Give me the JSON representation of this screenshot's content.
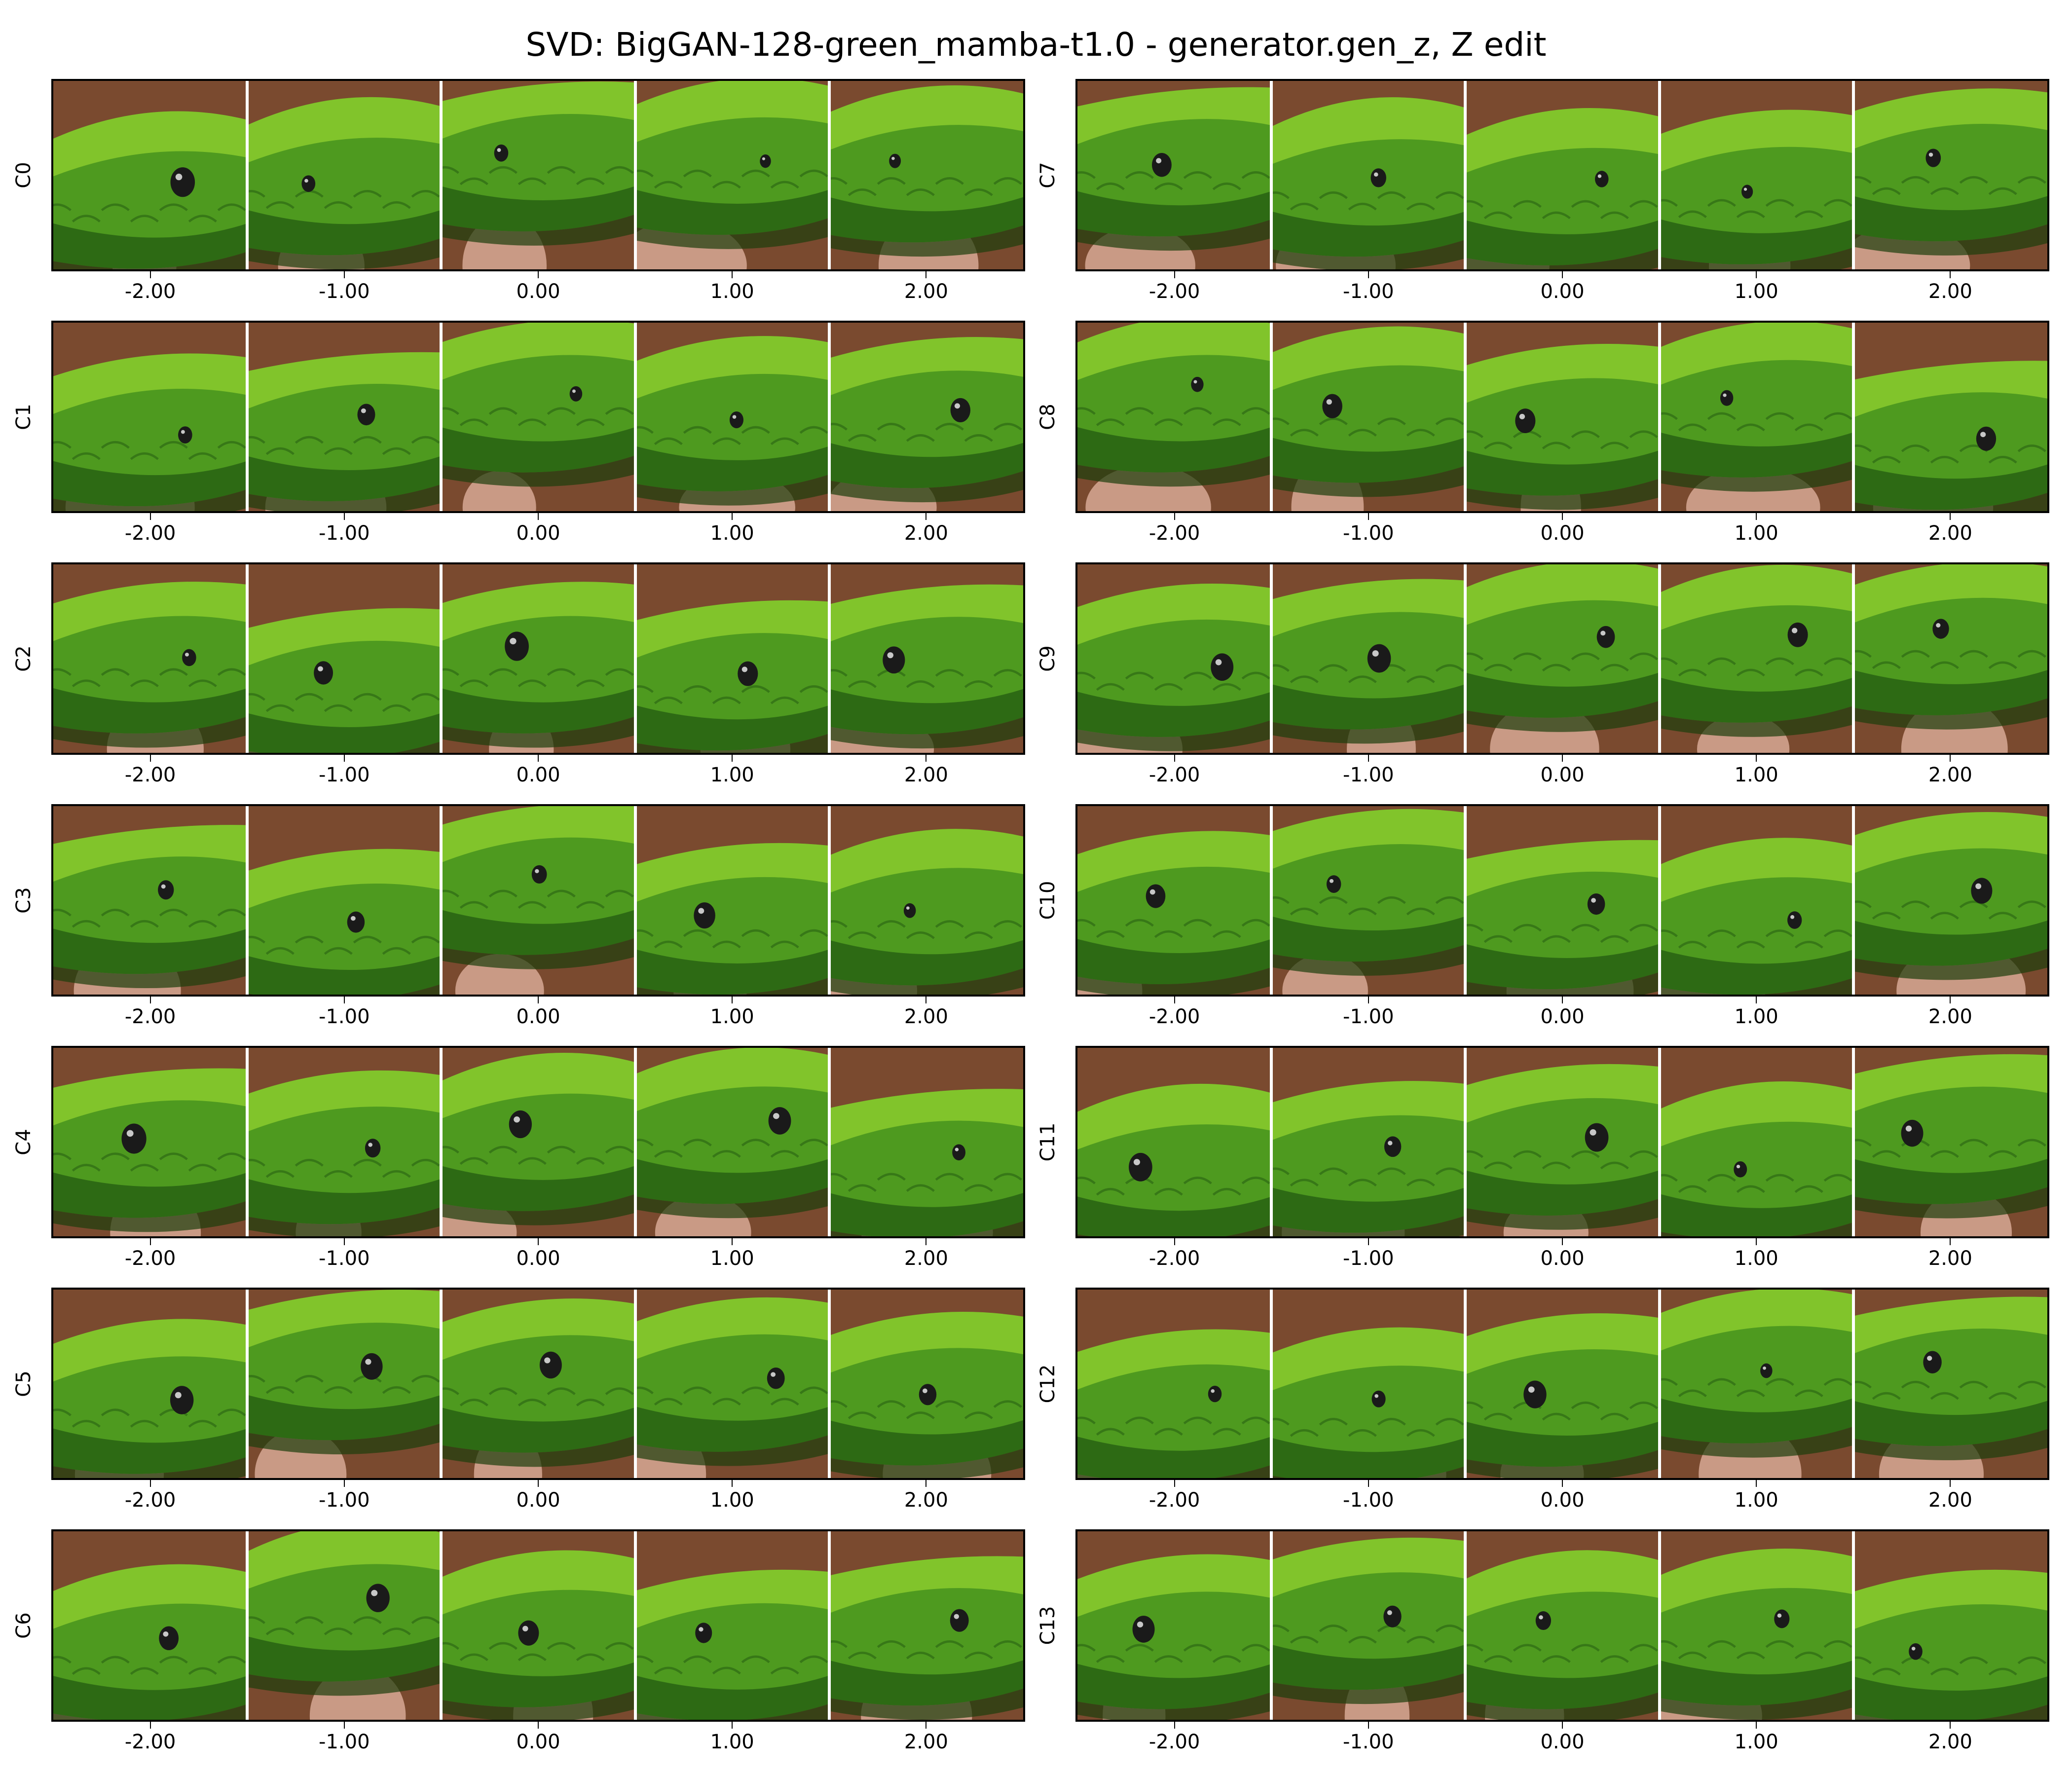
{
  "title": "SVD: BigGAN-128-green_mamba-t1.0 - generator.gen_z, Z edit",
  "tick_labels": [
    "-2.00",
    "-1.00",
    "0.00",
    "1.00",
    "2.00"
  ],
  "components": [
    "C0",
    "C1",
    "C2",
    "C3",
    "C4",
    "C5",
    "C6",
    "C7",
    "C8",
    "C9",
    "C10",
    "C11",
    "C12",
    "C13"
  ],
  "images_per_row": 5,
  "image_subject": "green-mamba-head",
  "colors": {
    "scale_light": "#8fce2e",
    "scale_mid": "#4e9a1f",
    "scale_dark": "#2d6a14",
    "scale_shadow": "#1c3d0c",
    "skin": "#c99a85",
    "background_brown": "#7a4a2f",
    "eye": "#1a1a1a",
    "separator": "#ffffff"
  }
}
